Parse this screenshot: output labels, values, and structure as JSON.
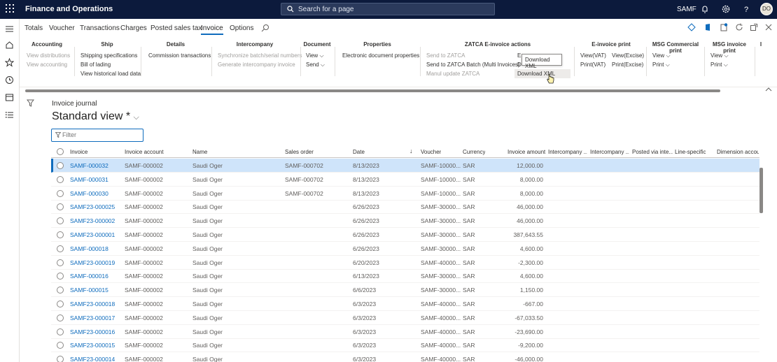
{
  "app": {
    "title": "Finance and Operations",
    "search_placeholder": "Search for a page",
    "company": "SAMF",
    "avatar": "DO"
  },
  "tabs": [
    {
      "label": "Totals"
    },
    {
      "label": "Voucher"
    },
    {
      "label": "Transactions"
    },
    {
      "label": "Charges"
    },
    {
      "label": "Posted sales tax"
    },
    {
      "label": "Invoice"
    },
    {
      "label": "Options"
    }
  ],
  "ribbon": {
    "accounting": {
      "title": "Accounting",
      "items": [
        "View distributions",
        "View accounting"
      ]
    },
    "ship": {
      "title": "Ship",
      "items": [
        "Shipping specifications",
        "Bill of lading",
        "View historical load data"
      ]
    },
    "details": {
      "title": "Details",
      "items": [
        "Commission transactions"
      ]
    },
    "intercompany": {
      "title": "Intercompany",
      "items": [
        "Synchronize batch/serial numbers",
        "Generate intercompany invoice"
      ]
    },
    "document": {
      "title": "Document",
      "items": [
        "View",
        "Send"
      ]
    },
    "properties": {
      "title": "Properties",
      "items": [
        "Electronic document properties"
      ]
    },
    "zatca": {
      "title": "ZATCA E-invoice actions",
      "items": [
        "Send to ZATCA",
        "Send to ZATCA Batch (Multi Invoices)",
        "Manul update ZATCA"
      ],
      "col2": [
        "E",
        "D"
      ],
      "download": "Download XML"
    },
    "einvoice": {
      "title": "E-invoice print",
      "items": [
        "View(VAT)",
        "Print(VAT)",
        "View(Excise)",
        "Print(Excise)"
      ]
    },
    "msgcomm": {
      "title": "MSG Commercial print",
      "items": [
        "View",
        "Print"
      ]
    },
    "msginv": {
      "title": "MSG invoice print",
      "items": [
        "View",
        "Print"
      ]
    },
    "extra": {
      "title": "I"
    }
  },
  "tooltip": "Download XML",
  "page": {
    "breadcrumb": "Invoice journal",
    "view_title": "Standard view *",
    "filter_placeholder": "Filter"
  },
  "columns": [
    "Invoice",
    "Invoice account",
    "Name",
    "Sales order",
    "Date",
    "Voucher",
    "Currency",
    "Invoice amount",
    "Intercompany ...",
    "Intercompany ...",
    "Posted via inte...",
    "Line-specific",
    "Dimension accou"
  ],
  "rows": [
    {
      "invoice": "SAMF-000032",
      "account": "SAMF-000002",
      "name": "Saudi Oger",
      "so": "SAMF-000702",
      "date": "8/13/2023",
      "voucher": "SAMF-10000...",
      "currency": "SAR",
      "amount": "12,000.00"
    },
    {
      "invoice": "SAMF-000031",
      "account": "SAMF-000002",
      "name": "Saudi Oger",
      "so": "SAMF-000702",
      "date": "8/13/2023",
      "voucher": "SAMF-10000...",
      "currency": "SAR",
      "amount": "8,000.00"
    },
    {
      "invoice": "SAMF-000030",
      "account": "SAMF-000002",
      "name": "Saudi Oger",
      "so": "SAMF-000702",
      "date": "8/13/2023",
      "voucher": "SAMF-10000...",
      "currency": "SAR",
      "amount": "8,000.00"
    },
    {
      "invoice": "SAMF23-000025",
      "account": "SAMF-000002",
      "name": "Saudi Oger",
      "so": "",
      "date": "6/26/2023",
      "voucher": "SAMF-30000...",
      "currency": "SAR",
      "amount": "46,000.00"
    },
    {
      "invoice": "SAMF23-000002",
      "account": "SAMF-000002",
      "name": "Saudi Oger",
      "so": "",
      "date": "6/26/2023",
      "voucher": "SAMF-30000...",
      "currency": "SAR",
      "amount": "46,000.00"
    },
    {
      "invoice": "SAMF23-000001",
      "account": "SAMF-000002",
      "name": "Saudi Oger",
      "so": "",
      "date": "6/26/2023",
      "voucher": "SAMF-30000...",
      "currency": "SAR",
      "amount": "387,643.55"
    },
    {
      "invoice": "SAMF-000018",
      "account": "SAMF-000002",
      "name": "Saudi Oger",
      "so": "",
      "date": "6/26/2023",
      "voucher": "SAMF-30000...",
      "currency": "SAR",
      "amount": "4,600.00"
    },
    {
      "invoice": "SAMF23-000019",
      "account": "SAMF-000002",
      "name": "Saudi Oger",
      "so": "",
      "date": "6/20/2023",
      "voucher": "SAMF-40000...",
      "currency": "SAR",
      "amount": "-2,300.00"
    },
    {
      "invoice": "SAMF-000016",
      "account": "SAMF-000002",
      "name": "Saudi Oger",
      "so": "",
      "date": "6/13/2023",
      "voucher": "SAMF-30000...",
      "currency": "SAR",
      "amount": "4,600.00"
    },
    {
      "invoice": "SAMF-000015",
      "account": "SAMF-000002",
      "name": "Saudi Oger",
      "so": "",
      "date": "6/6/2023",
      "voucher": "SAMF-30000...",
      "currency": "SAR",
      "amount": "1,150.00"
    },
    {
      "invoice": "SAMF23-000018",
      "account": "SAMF-000002",
      "name": "Saudi Oger",
      "so": "",
      "date": "6/3/2023",
      "voucher": "SAMF-40000...",
      "currency": "SAR",
      "amount": "-667.00"
    },
    {
      "invoice": "SAMF23-000017",
      "account": "SAMF-000002",
      "name": "Saudi Oger",
      "so": "",
      "date": "6/3/2023",
      "voucher": "SAMF-40000...",
      "currency": "SAR",
      "amount": "-67,033.50"
    },
    {
      "invoice": "SAMF23-000016",
      "account": "SAMF-000002",
      "name": "Saudi Oger",
      "so": "",
      "date": "6/3/2023",
      "voucher": "SAMF-40000...",
      "currency": "SAR",
      "amount": "-23,690.00"
    },
    {
      "invoice": "SAMF23-000015",
      "account": "SAMF-000002",
      "name": "Saudi Oger",
      "so": "",
      "date": "6/3/2023",
      "voucher": "SAMF-40000...",
      "currency": "SAR",
      "amount": "-9,200.00"
    },
    {
      "invoice": "SAMF23-000014",
      "account": "SAMF-000002",
      "name": "Saudi Oger",
      "so": "",
      "date": "6/3/2023",
      "voucher": "SAMF-40000...",
      "currency": "SAR",
      "amount": "-46,000.00"
    }
  ]
}
